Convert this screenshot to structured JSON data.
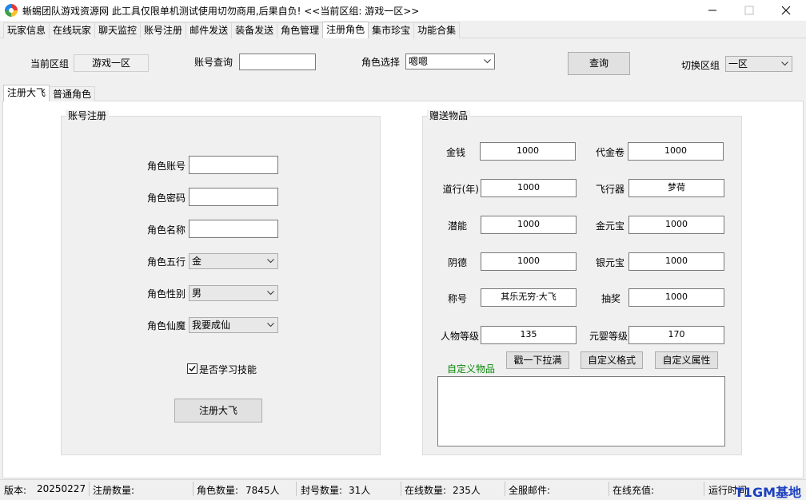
{
  "window": {
    "title": "蜥蜴团队游戏资源网 此工具仅限单机测试使用切勿商用,后果自负! <<当前区组: 游戏一区>>"
  },
  "main_tabs": [
    "玩家信息",
    "在线玩家",
    "聊天监控",
    "账号注册",
    "邮件发送",
    "装备发送",
    "角色管理",
    "注册角色",
    "集市珍宝",
    "功能合集"
  ],
  "query_bar": {
    "current_zone_label": "当前区组",
    "current_zone_value": "游戏一区",
    "account_query_label": "账号查询",
    "account_query_value": "",
    "role_select_label": "角色选择",
    "role_select_value": "嗯嗯",
    "query_button": "查询",
    "switch_zone_label": "切换区组",
    "switch_zone_value": "一区"
  },
  "sub_tabs": [
    "注册大飞",
    "普通角色"
  ],
  "account_register": {
    "group_title": "账号注册",
    "role_account_label": "角色账号",
    "role_account_value": "",
    "role_password_label": "角色密码",
    "role_password_value": "",
    "role_name_label": "角色名称",
    "role_name_value": "",
    "element_label": "角色五行",
    "element_value": "金",
    "gender_label": "角色性别",
    "gender_value": "男",
    "path_label": "角色仙魔",
    "path_value": "我要成仙",
    "learn_skill_label": "是否学习技能",
    "learn_skill_checked": true,
    "register_button": "注册大飞"
  },
  "gift_items": {
    "group_title": "赠送物品",
    "money_label": "金钱",
    "money_value": "1000",
    "voucher_label": "代金卷",
    "voucher_value": "1000",
    "daoxing_label": "道行(年)",
    "daoxing_value": "1000",
    "flyer_label": "飞行器",
    "flyer_value": "梦荷",
    "potential_label": "潜能",
    "potential_value": "1000",
    "gold_ingot_label": "金元宝",
    "gold_ingot_value": "1000",
    "yinde_label": "阴德",
    "yinde_value": "1000",
    "silver_ingot_label": "银元宝",
    "silver_ingot_value": "1000",
    "title_label": "称号",
    "title_value": "其乐无穷·大飞",
    "lottery_label": "抽奖",
    "lottery_value": "1000",
    "char_level_label": "人物等级",
    "char_level_value": "135",
    "yuanying_level_label": "元婴等级",
    "yuanying_level_value": "170",
    "custom_items_label": "自定义物品",
    "fill_max_button": "戳一下拉满",
    "custom_format_button": "自定义格式",
    "custom_attr_button": "自定义属性",
    "custom_items_value": ""
  },
  "status_bar": {
    "version_label": "版本:",
    "version_value": "20250227",
    "register_count_label": "注册数量:",
    "register_count_value": "",
    "role_count_label": "角色数量:",
    "role_count_value": "7845人",
    "ban_count_label": "封号数量:",
    "ban_count_value": "31人",
    "online_count_label": "在线数量:",
    "online_count_value": "235人",
    "server_mail_label": "全服邮件:",
    "server_mail_value": "",
    "online_recharge_label": "在线充值:",
    "online_recharge_value": "",
    "runtime_label": "运行时间",
    "watermark": "T1GM基地"
  },
  "colors": {
    "custom_items_label": "#0a8a0a",
    "watermark": "#1b3fbf",
    "active_tab_bg": "#ffffff",
    "window_bg": "#f0f0f0"
  }
}
